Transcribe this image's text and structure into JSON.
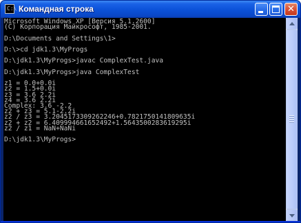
{
  "window": {
    "title": "Командная строка",
    "icon": "cmd-icon",
    "icon_glyph": "C:\\",
    "buttons": {
      "minimize": "minimize-icon",
      "maximize": "maximize-icon",
      "close": "close-icon",
      "close_glyph": "✕"
    }
  },
  "console": {
    "text_color": "#c0c0c0",
    "background": "#000000",
    "lines": [
      "Microsoft Windows XP [Версия 5.1.2600]",
      "(С) Корпорация Майкрософт, 1985-2001.",
      "",
      "D:\\Documents and Settings\\1>",
      "",
      "D:\\>cd jdk1.3\\MyProgs",
      "",
      "D:\\jdk1.3\\MyProgs>javac ComplexTest.java",
      "",
      "D:\\jdk1.3\\MyProgs>java ComplexTest",
      "",
      "z1 = 0.0+0.0i",
      "z2 = 1.5+0.0i",
      "z3 = 3.6 2.2i",
      "z4 = 3.6 2.2i",
      "Complex: 3.6 -2.2",
      "z2 + z3 = 5.1-2.2i",
      "z2 / z3 = 3.2045173309262246+0.7821750141809635i",
      "z2 + z2 = 6.409994661652492+1.5643500283619295i",
      "z2 / z1 = NaN+NaNi",
      "",
      "D:\\jdk1.3\\MyProgs>"
    ]
  },
  "scrollbar": {
    "up_icon": "scroll-up-arrow-icon",
    "down_icon": "scroll-down-arrow-icon"
  }
}
